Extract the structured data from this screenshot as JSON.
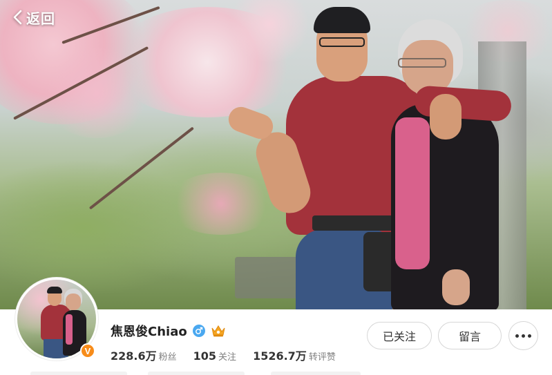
{
  "header": {
    "back_label": "返回"
  },
  "profile": {
    "username": "焦恩俊Chiao",
    "gender": "male",
    "verified_badge": "V",
    "stats": [
      {
        "value": "228.6万",
        "label": "粉丝"
      },
      {
        "value": "105",
        "label": "关注"
      },
      {
        "value": "1526.7万",
        "label": "转评赞"
      }
    ]
  },
  "actions": {
    "follow_label": "已关注",
    "message_label": "留言"
  },
  "colors": {
    "verify_badge": "#f78c1a",
    "gender_icon": "#4aa8f0",
    "crown_icon": "#f5a623"
  },
  "icons": {
    "back": "chevron-left-icon",
    "gender": "male-icon",
    "member": "crown-icon",
    "verified": "verified-v-icon",
    "more": "more-dots-icon"
  }
}
